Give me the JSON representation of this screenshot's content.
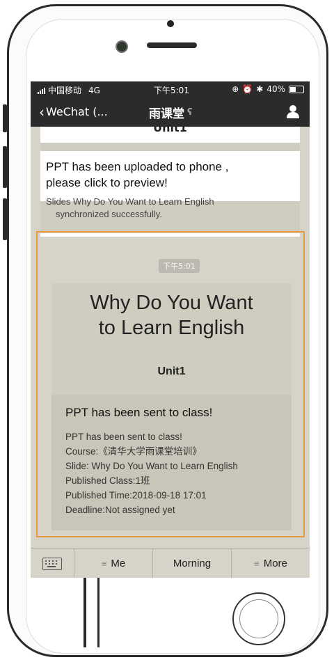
{
  "status_bar": {
    "carrier": "中国移动",
    "network": "4G",
    "time": "下午5:01",
    "battery": "40%"
  },
  "nav": {
    "back_label": "WeChat (...",
    "title": "雨课堂"
  },
  "messages": {
    "card1": {
      "unit": "Unit1",
      "title_line1": "PPT has been uploaded to phone ,",
      "title_line2": "please click to preview!",
      "sub_line1": "Slides Why Do You Want to Learn English",
      "sub_line2": "synchronized successfully."
    },
    "time_chip": "下午5:01",
    "card2": {
      "slide_title_line1": "Why Do You Want",
      "slide_title_line2": "to Learn English",
      "unit": "Unit1",
      "heading": "PPT has been sent to class!",
      "line1": "PPT has been sent to class!",
      "line2": "Course:《清华大学雨课堂培训》",
      "line3": "Slide:  Why Do You Want to Learn English",
      "line4": "Published Class:1班",
      "line5": "Published Time:2018-09-18 17:01",
      "line6": "Deadline:Not assigned yet"
    }
  },
  "menu": {
    "items": [
      {
        "label": "Me",
        "icon": "menu-lines-icon"
      },
      {
        "label": "Morning",
        "icon": ""
      },
      {
        "label": "More",
        "icon": "menu-lines-icon"
      }
    ]
  },
  "colors": {
    "nav_bg": "#2b2b2b",
    "highlight_border": "#e89a3c",
    "chat_bg": "#d6d4c8"
  }
}
